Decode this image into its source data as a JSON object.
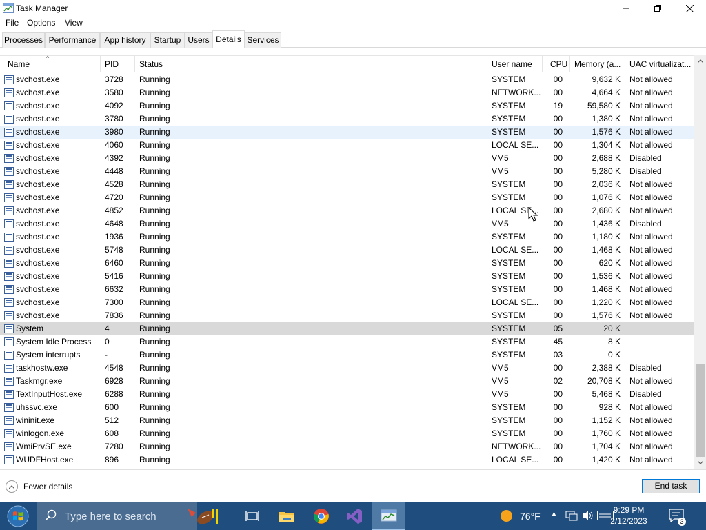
{
  "window": {
    "title": "Task Manager"
  },
  "menu": [
    "File",
    "Options",
    "View"
  ],
  "tabs": [
    "Processes",
    "Performance",
    "App history",
    "Startup",
    "Users",
    "Details",
    "Services"
  ],
  "active_tab": "Details",
  "columns": {
    "name": "Name",
    "pid": "PID",
    "status": "Status",
    "user": "User name",
    "cpu": "CPU",
    "memory": "Memory (a...",
    "uac": "UAC virtualizat..."
  },
  "rows": [
    {
      "name": "svchost.exe",
      "pid": "3728",
      "status": "Running",
      "user": "SYSTEM",
      "cpu": "00",
      "mem": "9,632 K",
      "uac": "Not allowed"
    },
    {
      "name": "svchost.exe",
      "pid": "3580",
      "status": "Running",
      "user": "NETWORK...",
      "cpu": "00",
      "mem": "4,664 K",
      "uac": "Not allowed"
    },
    {
      "name": "svchost.exe",
      "pid": "4092",
      "status": "Running",
      "user": "SYSTEM",
      "cpu": "19",
      "mem": "59,580 K",
      "uac": "Not allowed"
    },
    {
      "name": "svchost.exe",
      "pid": "3780",
      "status": "Running",
      "user": "SYSTEM",
      "cpu": "00",
      "mem": "1,380 K",
      "uac": "Not allowed"
    },
    {
      "name": "svchost.exe",
      "pid": "3980",
      "status": "Running",
      "user": "SYSTEM",
      "cpu": "00",
      "mem": "1,576 K",
      "uac": "Not allowed",
      "state": "hover"
    },
    {
      "name": "svchost.exe",
      "pid": "4060",
      "status": "Running",
      "user": "LOCAL SE...",
      "cpu": "00",
      "mem": "1,304 K",
      "uac": "Not allowed"
    },
    {
      "name": "svchost.exe",
      "pid": "4392",
      "status": "Running",
      "user": "VM5",
      "cpu": "00",
      "mem": "2,688 K",
      "uac": "Disabled"
    },
    {
      "name": "svchost.exe",
      "pid": "4448",
      "status": "Running",
      "user": "VM5",
      "cpu": "00",
      "mem": "5,280 K",
      "uac": "Disabled"
    },
    {
      "name": "svchost.exe",
      "pid": "4528",
      "status": "Running",
      "user": "SYSTEM",
      "cpu": "00",
      "mem": "2,036 K",
      "uac": "Not allowed"
    },
    {
      "name": "svchost.exe",
      "pid": "4720",
      "status": "Running",
      "user": "SYSTEM",
      "cpu": "00",
      "mem": "1,076 K",
      "uac": "Not allowed"
    },
    {
      "name": "svchost.exe",
      "pid": "4852",
      "status": "Running",
      "user": "LOCAL SE...",
      "cpu": "00",
      "mem": "2,680 K",
      "uac": "Not allowed"
    },
    {
      "name": "svchost.exe",
      "pid": "4648",
      "status": "Running",
      "user": "VM5",
      "cpu": "00",
      "mem": "1,436 K",
      "uac": "Disabled"
    },
    {
      "name": "svchost.exe",
      "pid": "1936",
      "status": "Running",
      "user": "SYSTEM",
      "cpu": "00",
      "mem": "1,180 K",
      "uac": "Not allowed"
    },
    {
      "name": "svchost.exe",
      "pid": "5748",
      "status": "Running",
      "user": "LOCAL SE...",
      "cpu": "00",
      "mem": "1,468 K",
      "uac": "Not allowed"
    },
    {
      "name": "svchost.exe",
      "pid": "6460",
      "status": "Running",
      "user": "SYSTEM",
      "cpu": "00",
      "mem": "620 K",
      "uac": "Not allowed"
    },
    {
      "name": "svchost.exe",
      "pid": "5416",
      "status": "Running",
      "user": "SYSTEM",
      "cpu": "00",
      "mem": "1,536 K",
      "uac": "Not allowed"
    },
    {
      "name": "svchost.exe",
      "pid": "6632",
      "status": "Running",
      "user": "SYSTEM",
      "cpu": "00",
      "mem": "1,468 K",
      "uac": "Not allowed"
    },
    {
      "name": "svchost.exe",
      "pid": "7300",
      "status": "Running",
      "user": "LOCAL SE...",
      "cpu": "00",
      "mem": "1,220 K",
      "uac": "Not allowed"
    },
    {
      "name": "svchost.exe",
      "pid": "7836",
      "status": "Running",
      "user": "SYSTEM",
      "cpu": "00",
      "mem": "1,576 K",
      "uac": "Not allowed"
    },
    {
      "name": "System",
      "pid": "4",
      "status": "Running",
      "user": "SYSTEM",
      "cpu": "05",
      "mem": "20 K",
      "uac": "",
      "state": "selected"
    },
    {
      "name": "System Idle Process",
      "pid": "0",
      "status": "Running",
      "user": "SYSTEM",
      "cpu": "45",
      "mem": "8 K",
      "uac": ""
    },
    {
      "name": "System interrupts",
      "pid": "-",
      "status": "Running",
      "user": "SYSTEM",
      "cpu": "03",
      "mem": "0 K",
      "uac": ""
    },
    {
      "name": "taskhostw.exe",
      "pid": "4548",
      "status": "Running",
      "user": "VM5",
      "cpu": "00",
      "mem": "2,388 K",
      "uac": "Disabled"
    },
    {
      "name": "Taskmgr.exe",
      "pid": "6928",
      "status": "Running",
      "user": "VM5",
      "cpu": "02",
      "mem": "20,708 K",
      "uac": "Not allowed"
    },
    {
      "name": "TextInputHost.exe",
      "pid": "6288",
      "status": "Running",
      "user": "VM5",
      "cpu": "00",
      "mem": "5,468 K",
      "uac": "Disabled"
    },
    {
      "name": "uhssvc.exe",
      "pid": "600",
      "status": "Running",
      "user": "SYSTEM",
      "cpu": "00",
      "mem": "928 K",
      "uac": "Not allowed"
    },
    {
      "name": "wininit.exe",
      "pid": "512",
      "status": "Running",
      "user": "SYSTEM",
      "cpu": "00",
      "mem": "1,152 K",
      "uac": "Not allowed"
    },
    {
      "name": "winlogon.exe",
      "pid": "608",
      "status": "Running",
      "user": "SYSTEM",
      "cpu": "00",
      "mem": "1,760 K",
      "uac": "Not allowed"
    },
    {
      "name": "WmiPrvSE.exe",
      "pid": "7280",
      "status": "Running",
      "user": "NETWORK...",
      "cpu": "00",
      "mem": "1,704 K",
      "uac": "Not allowed"
    },
    {
      "name": "WUDFHost.exe",
      "pid": "896",
      "status": "Running",
      "user": "LOCAL SE...",
      "cpu": "00",
      "mem": "1,420 K",
      "uac": "Not allowed"
    }
  ],
  "footer": {
    "fewer_details": "Fewer details",
    "end_task": "End task"
  },
  "taskbar": {
    "search_placeholder": "Type here to search",
    "weather_temp": "76°F",
    "time": "9:29 PM",
    "date": "2/12/2023",
    "notification_count": "3",
    "accent": "#1f4d7d"
  }
}
